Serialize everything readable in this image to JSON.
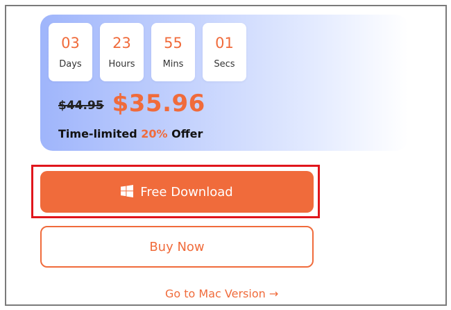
{
  "countdown": [
    {
      "value": "03",
      "unit": "Days"
    },
    {
      "value": "23",
      "unit": "Hours"
    },
    {
      "value": "55",
      "unit": "Mins"
    },
    {
      "value": "01",
      "unit": "Secs"
    }
  ],
  "pricing": {
    "original_price": "$44.95",
    "sale_price": "$35.96",
    "offer_prefix": "Time-limited ",
    "offer_percent": "20%",
    "offer_suffix": " Offer"
  },
  "buttons": {
    "download_icon": "windows-icon",
    "download_label": "Free Download",
    "buy_label": "Buy Now"
  },
  "links": {
    "mac_version": "Go to Mac Version →"
  },
  "colors": {
    "accent": "#f06b3b",
    "highlight_border": "#e0161c",
    "frame_border": "#7a7a7a",
    "card_gradient_start": "#9fb5fb"
  }
}
